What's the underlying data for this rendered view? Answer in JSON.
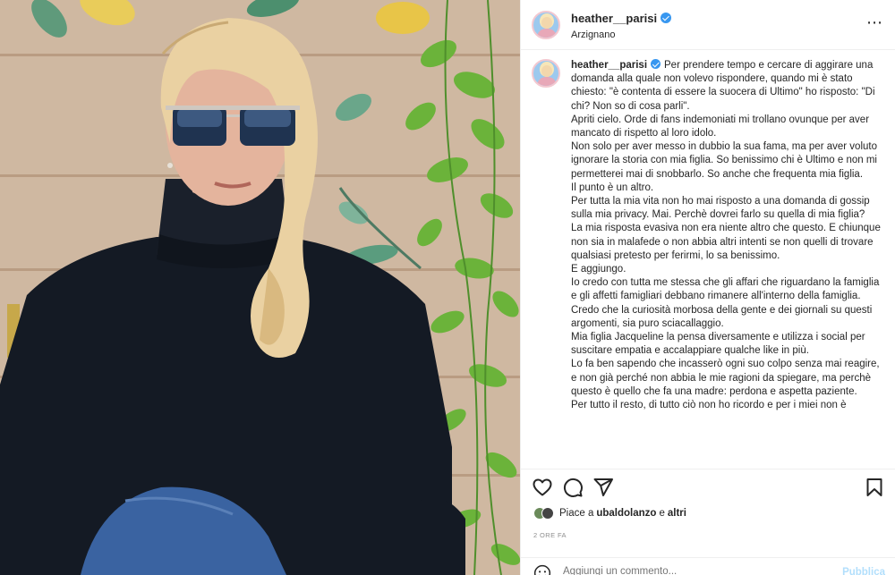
{
  "post": {
    "username": "heather__parisi",
    "location": "Arzignano",
    "caption_lines": [
      "Per prendere tempo e cercare di aggirare una domanda alla quale non volevo rispondere, quando mi è stato chiesto: \"è contenta di essere la suocera di Ultimo\" ho risposto: \"Di chi? Non so di cosa parli\".",
      "Apriti cielo. Orde di fans indemoniati mi trollano ovunque per aver mancato di rispetto al loro idolo.",
      "Non solo per aver messo in dubbio la sua fama, ma per aver voluto ignorare la storia con mia figlia. So benissimo chi è Ultimo e non mi permetterei mai di snobbarlo. So anche che frequenta mia figlia.",
      "Il punto è un altro.",
      "Per tutta la mia vita non ho mai risposto a una domanda di gossip sulla mia privacy. Mai. Perchè dovrei farlo su quella di mia figlia?",
      "La mia risposta evasiva non era niente altro che questo. E chiunque non sia in malafede o non abbia altri intenti se non quelli di trovare qualsiasi pretesto per ferirmi, lo sa benissimo.",
      "E aggiungo.",
      "Io credo con tutta me stessa che gli affari che riguardano la famiglia e gli affetti famigliari debbano rimanere all'interno della famiglia.",
      "Credo che la curiosità morbosa della gente e dei giornali su questi argomenti, sia puro sciacallaggio.",
      "Mia figlia Jacqueline la pensa diversamente e utilizza i social per suscitare empatia e accalappiare qualche like in più.",
      "Lo fa ben sapendo che incasserò ogni suo colpo senza mai reagire, e non già perché non abbia le mie ragioni da spiegare, ma perchè questo è quello che fa una madre: perdona e aspetta paziente.",
      "Per tutto il resto, di tutto ciò non ho ricordo e per i miei non è"
    ],
    "likes": {
      "prefix": "Piace a",
      "user": "ubaldolanzo",
      "suffix": "e",
      "others": "altri"
    },
    "timestamp": "2 ORE FA",
    "comment": {
      "placeholder": "Aggiungi un commento...",
      "publish": "Pubblica"
    },
    "icons": {
      "like": "heart-icon",
      "comment": "comment-icon",
      "share": "share-icon",
      "save": "bookmark-icon",
      "more": "more-options-icon",
      "emoji": "emoji-icon",
      "verified": "verified-badge-icon"
    },
    "colors": {
      "verified": "#3897f0",
      "muted": "#8e8e8e",
      "publish": "#b2dffc"
    }
  }
}
